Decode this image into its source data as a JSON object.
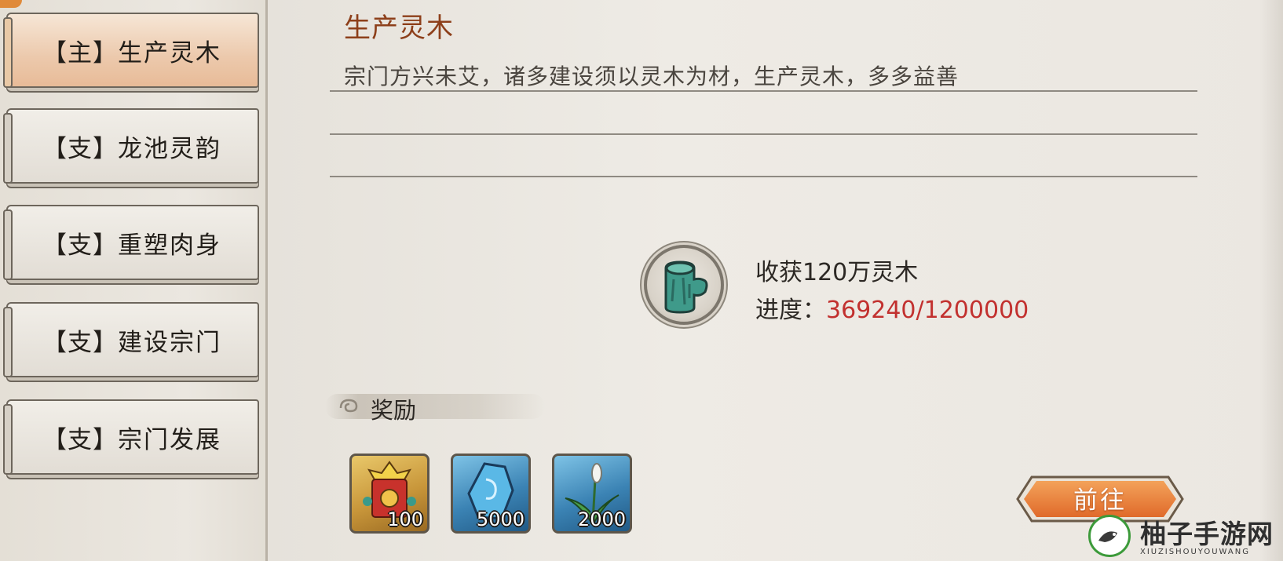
{
  "quest_tabs": [
    {
      "prefix": "【主】",
      "label": "生产灵木",
      "active": true
    },
    {
      "prefix": "【支】",
      "label": "龙池灵韵",
      "active": false
    },
    {
      "prefix": "【支】",
      "label": "重塑肉身",
      "active": false
    },
    {
      "prefix": "【支】",
      "label": "建设宗门",
      "active": false
    },
    {
      "prefix": "【支】",
      "label": "宗门发展",
      "active": false
    }
  ],
  "quest": {
    "title": "生产灵木",
    "description": "宗门方兴未艾，诸多建设须以灵木为材，生产灵木，多多益善"
  },
  "goal": {
    "icon": "spirit-wood-log-icon",
    "title": "收获120万灵木",
    "progress_label": "进度：",
    "progress_value": "369240/1200000",
    "progress_current": 369240,
    "progress_total": 1200000
  },
  "rewards": {
    "header": "奖励",
    "items": [
      {
        "icon": "sect-banner-icon",
        "qty": "100"
      },
      {
        "icon": "spirit-stone-icon",
        "qty": "5000"
      },
      {
        "icon": "spirit-herb-icon",
        "qty": "2000"
      }
    ]
  },
  "actions": {
    "go_label": "前往"
  },
  "watermark": {
    "title": "柚子手游网",
    "subtitle": "XIUZISHOUYOUWANG"
  },
  "colors": {
    "title": "#8d3f1a",
    "progress_value": "#c2312f",
    "active_tab": "#ecc9ac",
    "go_button": "#e8793a"
  }
}
